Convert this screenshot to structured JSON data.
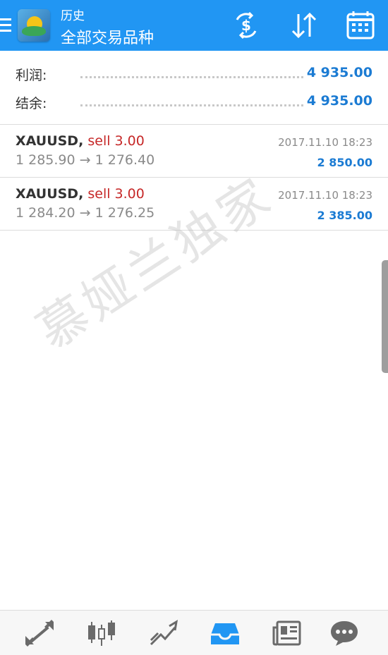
{
  "header": {
    "title": "历史",
    "subtitle": "全部交易品种"
  },
  "summary": {
    "profit": {
      "label": "利润:",
      "value": "4 935.00"
    },
    "balance": {
      "label": "结余:",
      "value": "4 935.00"
    }
  },
  "trades": [
    {
      "symbol": "XAUUSD,",
      "side": "sell 3.00",
      "prices": "1 285.90 → 1 276.40",
      "time": "2017.11.10 18:23",
      "profit": "2 850.00"
    },
    {
      "symbol": "XAUUSD,",
      "side": "sell 3.00",
      "prices": "1 284.20 → 1 276.25",
      "time": "2017.11.10 18:23",
      "profit": "2 385.00"
    }
  ],
  "watermark": "慕娅兰独家",
  "colors": {
    "header_bg": "#2196f3",
    "profit_blue": "#1b7bd3",
    "sell_red": "#c62828"
  },
  "icons": {
    "toolbar": [
      "currency-exchange-icon",
      "sort-icon",
      "calendar-icon"
    ],
    "bottom_nav": [
      "quotes-icon",
      "chart-icon",
      "trade-icon",
      "history-icon",
      "news-icon",
      "chat-icon"
    ]
  }
}
